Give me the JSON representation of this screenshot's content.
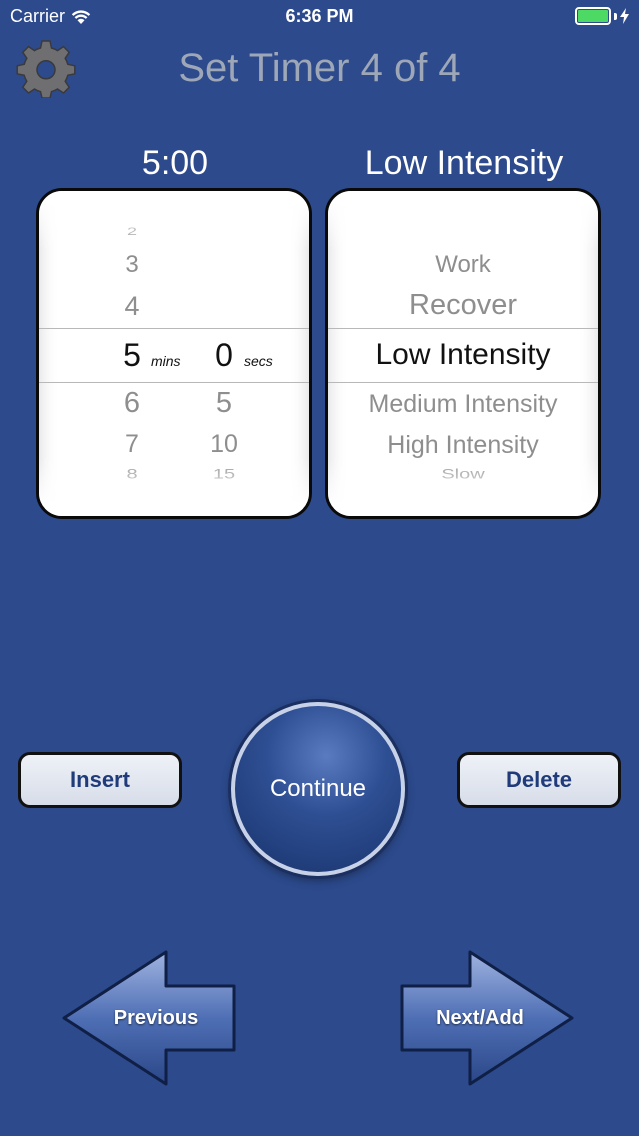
{
  "status_bar": {
    "carrier": "Carrier",
    "time": "6:36 PM",
    "battery_color": "#4cd964"
  },
  "header": {
    "title": "Set Timer 4 of 4",
    "settings_icon": "gear-icon"
  },
  "time_picker": {
    "display": "5:00",
    "minutes": [
      "2",
      "3",
      "4",
      "5",
      "6",
      "7",
      "8"
    ],
    "seconds": [
      "0",
      "5",
      "10",
      "15"
    ],
    "selected_minutes": "5",
    "selected_seconds": "0",
    "minutes_unit": "mins",
    "seconds_unit": "secs"
  },
  "intensity_picker": {
    "display": "Low Intensity",
    "options": [
      "Work",
      "Recover",
      "Low Intensity",
      "Medium Intensity",
      "High Intensity",
      "Slow"
    ],
    "selected": "Low Intensity"
  },
  "buttons": {
    "insert": "Insert",
    "continue": "Continue",
    "delete": "Delete",
    "previous": "Previous",
    "next": "Next/Add"
  },
  "colors": {
    "background": "#2c4a8c",
    "title": "#9ea7b7",
    "button_text": "#1f3b7a"
  }
}
